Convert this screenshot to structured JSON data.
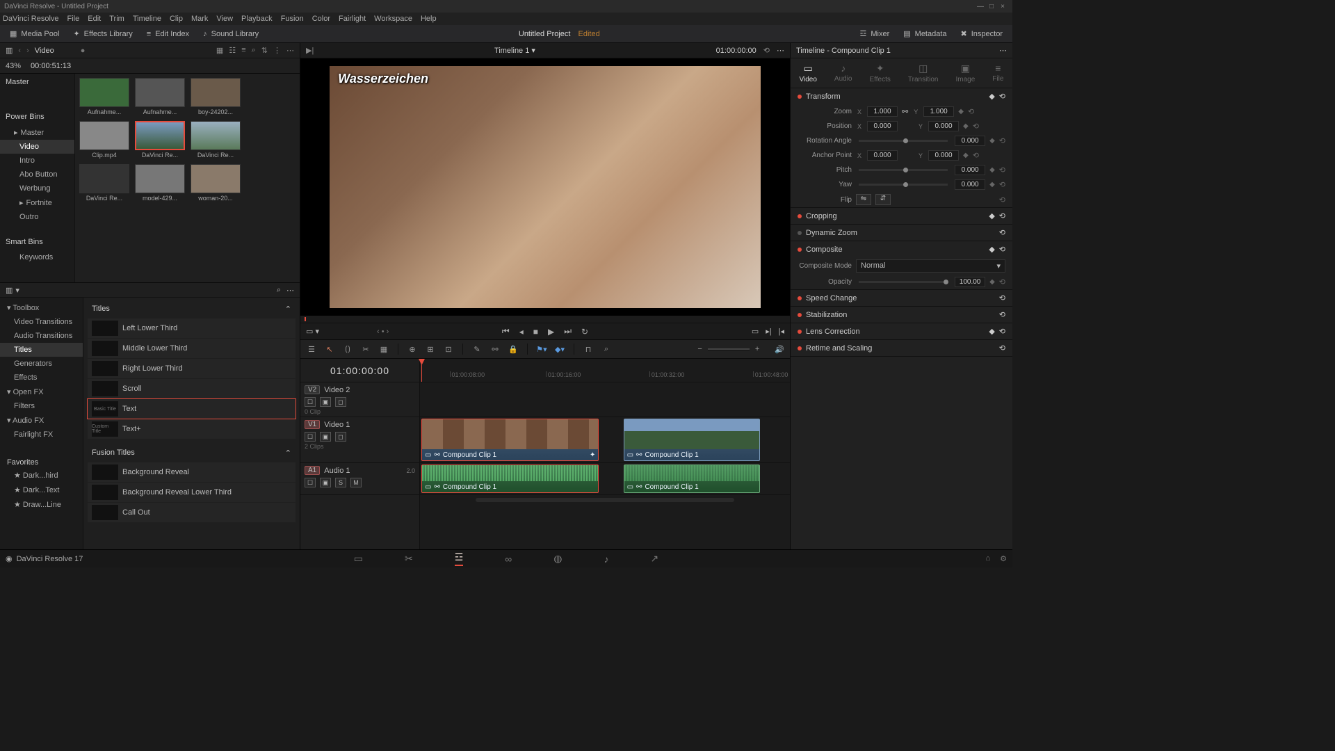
{
  "titlebar": {
    "app": "DaVinci Resolve - Untitled Project"
  },
  "menu": [
    "DaVinci Resolve",
    "File",
    "Edit",
    "Trim",
    "Timeline",
    "Clip",
    "Mark",
    "View",
    "Playback",
    "Fusion",
    "Color",
    "Fairlight",
    "Workspace",
    "Help"
  ],
  "toolbar": {
    "media_pool": "Media Pool",
    "effects_lib": "Effects Library",
    "edit_index": "Edit Index",
    "sound_lib": "Sound Library",
    "project": "Untitled Project",
    "edited": "Edited",
    "mixer": "Mixer",
    "metadata": "Metadata",
    "inspector": "Inspector"
  },
  "pool": {
    "crumb": "Video",
    "zoom_pct": "43%",
    "duration": "00:00:51:13",
    "bins_hdr": "Master",
    "power_bins": "Power Bins",
    "master": "Master",
    "smart_bins": "Smart Bins",
    "keywords": "Keywords",
    "bins": [
      "Video",
      "Intro",
      "Abo Button",
      "Werbung",
      "Fortnite",
      "Outro"
    ],
    "thumbs": [
      {
        "label": "Aufnahme..."
      },
      {
        "label": "Aufnahme..."
      },
      {
        "label": "boy-24202..."
      },
      {
        "label": "Clip.mp4"
      },
      {
        "label": "DaVinci Re...",
        "sel": true
      },
      {
        "label": "DaVinci Re..."
      },
      {
        "label": "DaVinci Re..."
      },
      {
        "label": "model-429..."
      },
      {
        "label": "woman-20..."
      }
    ]
  },
  "fx": {
    "tree": [
      {
        "label": "Toolbox",
        "hdr": true
      },
      {
        "label": "Video Transitions"
      },
      {
        "label": "Audio Transitions"
      },
      {
        "label": "Titles",
        "sel": true
      },
      {
        "label": "Generators"
      },
      {
        "label": "Effects"
      },
      {
        "label": "Open FX",
        "hdr": true
      },
      {
        "label": "Filters"
      },
      {
        "label": "Audio FX",
        "hdr": true
      },
      {
        "label": "Fairlight FX"
      }
    ],
    "favorites": "Favorites",
    "fav_items": [
      "Dark...hird",
      "Dark...Text",
      "Draw...Line"
    ],
    "cat_titles": "Titles",
    "cat_fusion": "Fusion Titles",
    "items": [
      {
        "name": "Left Lower Third"
      },
      {
        "name": "Middle Lower Third"
      },
      {
        "name": "Right Lower Third"
      },
      {
        "name": "Scroll"
      },
      {
        "name": "Text",
        "sel": true,
        "prev": "Basic Title"
      },
      {
        "name": "Text+",
        "prev": "Custom Title"
      }
    ],
    "fusion_items": [
      {
        "name": "Background Reveal"
      },
      {
        "name": "Background Reveal Lower Third"
      },
      {
        "name": "Call Out"
      }
    ]
  },
  "viewer": {
    "timeline_name": "Timeline 1",
    "tc_right": "01:00:00:00",
    "watermark": "Wasserzeichen"
  },
  "timeline": {
    "tc": "01:00:00:00",
    "ruler": [
      "01:00:08:00",
      "01:00:16:00",
      "01:00:32:00",
      "01:00:48:00"
    ],
    "v2": {
      "badge": "V2",
      "name": "Video 2",
      "clips": "0 Clip"
    },
    "v1": {
      "badge": "V1",
      "name": "Video 1",
      "clips": "2 Clips"
    },
    "a1": {
      "badge": "A1",
      "name": "Audio 1",
      "meter": "2.0"
    },
    "clip1": "Compound Clip 1",
    "clip2": "Compound Clip 1"
  },
  "inspector": {
    "head": "Timeline - Compound Clip 1",
    "tabs": [
      "Video",
      "Audio",
      "Effects",
      "Transition",
      "Image",
      "File"
    ],
    "transform": "Transform",
    "zoom_lbl": "Zoom",
    "zoom_x": "1.000",
    "zoom_y": "1.000",
    "pos_lbl": "Position",
    "pos_x": "0.000",
    "pos_y": "0.000",
    "rot_lbl": "Rotation Angle",
    "rot": "0.000",
    "anchor_lbl": "Anchor Point",
    "anchor_x": "0.000",
    "anchor_y": "0.000",
    "pitch_lbl": "Pitch",
    "pitch": "0.000",
    "yaw_lbl": "Yaw",
    "yaw": "0.000",
    "flip_lbl": "Flip",
    "cropping": "Cropping",
    "dynzoom": "Dynamic Zoom",
    "composite": "Composite",
    "comp_mode_lbl": "Composite Mode",
    "comp_mode": "Normal",
    "opacity_lbl": "Opacity",
    "opacity": "100.00",
    "speed": "Speed Change",
    "stab": "Stabilization",
    "lens": "Lens Correction",
    "retime": "Retime and Scaling"
  },
  "footer": {
    "app": "DaVinci Resolve 17"
  }
}
